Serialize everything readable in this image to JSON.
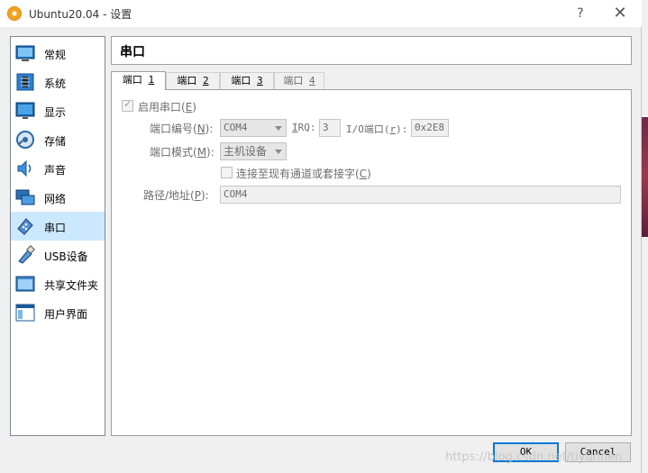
{
  "window": {
    "title": "Ubuntu20.04 - 设置",
    "help_label": "?",
    "close_label": "✕"
  },
  "sidebar": {
    "items": [
      {
        "label": "常规",
        "icon": "general-icon"
      },
      {
        "label": "系统",
        "icon": "system-icon"
      },
      {
        "label": "显示",
        "icon": "display-icon"
      },
      {
        "label": "存储",
        "icon": "storage-icon"
      },
      {
        "label": "声音",
        "icon": "audio-icon"
      },
      {
        "label": "网络",
        "icon": "network-icon"
      },
      {
        "label": "串口",
        "icon": "serial-port-icon",
        "selected": true
      },
      {
        "label": "USB设备",
        "icon": "usb-icon"
      },
      {
        "label": "共享文件夹",
        "icon": "shared-folder-icon"
      },
      {
        "label": "用户界面",
        "icon": "user-interface-icon"
      }
    ]
  },
  "page": {
    "title": "串口"
  },
  "tabs": [
    {
      "prefix": "端口 ",
      "key": "1",
      "active": true
    },
    {
      "prefix": "端口 ",
      "key": "2"
    },
    {
      "prefix": "端口 ",
      "key": "3"
    },
    {
      "prefix": "端口 ",
      "key": "4",
      "dim": true
    }
  ],
  "form": {
    "enable": {
      "label": "启用串口(",
      "key": "E",
      "suffix": ")",
      "checked": true
    },
    "port_number": {
      "label": "端口编号(",
      "key": "N",
      "suffix": "):",
      "value": "COM4"
    },
    "irq": {
      "key": "I",
      "label": "RQ:",
      "value": "3"
    },
    "io_port": {
      "label": "I/O端口(",
      "key": "r",
      "suffix": "):",
      "value": "0x2E8"
    },
    "port_mode": {
      "label": "端口模式(",
      "key": "M",
      "suffix": "):",
      "value": "主机设备"
    },
    "connect_existing": {
      "label": "连接至现有通道或套接字(",
      "key": "C",
      "suffix": ")",
      "checked": false
    },
    "path": {
      "label": "路径/地址(",
      "key": "P",
      "suffix": "):",
      "value": "COM4"
    }
  },
  "buttons": {
    "ok": "OK",
    "cancel": "Cancel"
  },
  "watermark": "https://blog.csdn.net/tiyunhen"
}
